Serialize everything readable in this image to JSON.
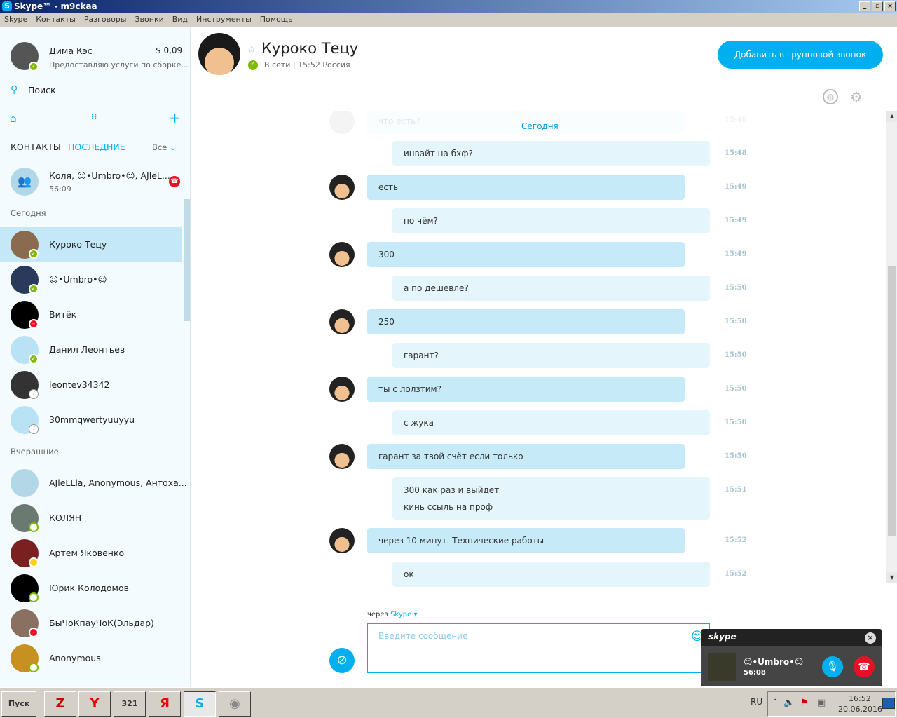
{
  "window": {
    "title": "Skype™ - m9ckaa",
    "buttons": [
      "_",
      "▫",
      "×"
    ]
  },
  "menu": [
    "Skype",
    "Контакты",
    "Разговоры",
    "Звонки",
    "Вид",
    "Инструменты",
    "Помощь"
  ],
  "profile": {
    "name": "Дима Кэс",
    "balance": "$ 0,09",
    "mood": "Предоставляю услуги по сборке..."
  },
  "search_label": "Поиск",
  "tabs": {
    "contacts": "КОНТАКТЫ",
    "recent": "ПОСЛЕДНИЕ",
    "filter": "Все"
  },
  "active_call": {
    "name": "Коля, ☺•Umbro•☺, AJleL...",
    "duration": "56:09"
  },
  "sections": {
    "today": "Сегодня",
    "yesterday": "Вчерашние"
  },
  "today_contacts": [
    {
      "name": "Куроко Тецу",
      "status": "online"
    },
    {
      "name": "☺•Umbro•☺",
      "status": "online"
    },
    {
      "name": "Витёк",
      "status": "dnd"
    },
    {
      "name": "Данил Леонтьев",
      "status": "online"
    },
    {
      "name": "leontev34342",
      "status": "unknown"
    },
    {
      "name": "30mmqwertyuuyyu",
      "status": "unknown"
    }
  ],
  "yesterday_contacts": [
    {
      "name": "AJleLLla, Anonymous, Антоха...",
      "status": "group"
    },
    {
      "name": "КОЛЯН",
      "status": "offline"
    },
    {
      "name": "Артем Яковенко",
      "status": "away"
    },
    {
      "name": "Юрик Колодомов",
      "status": "offline"
    },
    {
      "name": "БыЧоКпауЧоК(Эльдар)",
      "status": "dnd"
    },
    {
      "name": "Anonymous",
      "status": "offline"
    }
  ],
  "chat_header": {
    "name": "Куроко Тецу",
    "status": "В сети",
    "local_time": "15:52 Россия",
    "separator": "|",
    "add_call_button": "Добавить в групповой звонок"
  },
  "date_divider": "Сегодня",
  "faded_message": {
    "text": "что есть?",
    "time": "15:48"
  },
  "messages": [
    {
      "dir": "out",
      "text": "инвайт на бхф?",
      "time": "15:48"
    },
    {
      "dir": "in",
      "text": "есть",
      "time": "15:49"
    },
    {
      "dir": "out",
      "text": "по чём?",
      "time": "15:49"
    },
    {
      "dir": "in",
      "text": "300",
      "time": "15:49"
    },
    {
      "dir": "out",
      "text": "а по дешевле?",
      "time": "15:50"
    },
    {
      "dir": "in",
      "text": "250",
      "time": "15:50"
    },
    {
      "dir": "out",
      "text": "гарант?",
      "time": "15:50"
    },
    {
      "dir": "in",
      "text": "ты с лолзтим?",
      "time": "15:50"
    },
    {
      "dir": "out",
      "text": "с жука",
      "time": "15:50"
    },
    {
      "dir": "in",
      "text": "гарант за твой счёт если только",
      "time": "15:50"
    },
    {
      "dir": "out",
      "text": "300 как раз и выйдет",
      "text2": "кинь ссыль на проф",
      "time": "15:51"
    },
    {
      "dir": "in",
      "text": "через 10 минут. Технические работы",
      "time": "15:52"
    },
    {
      "dir": "out",
      "text": "ок",
      "time": "15:52"
    }
  ],
  "composer": {
    "via": "через",
    "service": "Skype",
    "placeholder": "Введите сообщение"
  },
  "call_popup": {
    "brand": "skype",
    "name": "☺•Umbro•☺",
    "duration": "56:08"
  },
  "taskbar": {
    "start": "Пуск",
    "lang": "RU",
    "time": "16:52",
    "date": "20.06.2016"
  }
}
